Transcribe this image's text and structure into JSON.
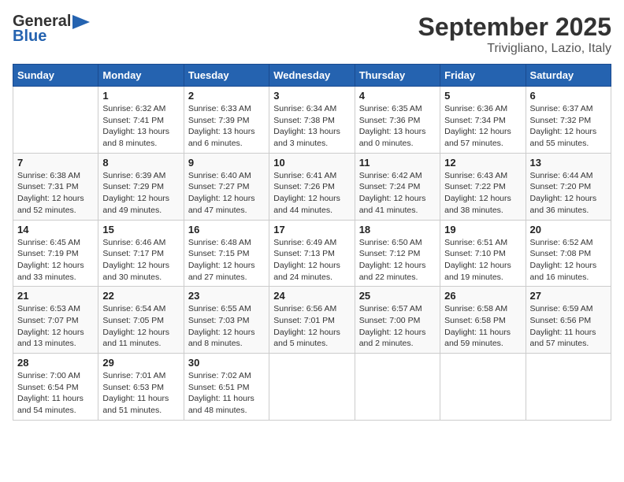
{
  "header": {
    "logo_general": "General",
    "logo_blue": "Blue",
    "month": "September 2025",
    "location": "Trivigliano, Lazio, Italy"
  },
  "days_of_week": [
    "Sunday",
    "Monday",
    "Tuesday",
    "Wednesday",
    "Thursday",
    "Friday",
    "Saturday"
  ],
  "weeks": [
    [
      {
        "day": "",
        "sunrise": "",
        "sunset": "",
        "daylight": ""
      },
      {
        "day": "1",
        "sunrise": "Sunrise: 6:32 AM",
        "sunset": "Sunset: 7:41 PM",
        "daylight": "Daylight: 13 hours and 8 minutes."
      },
      {
        "day": "2",
        "sunrise": "Sunrise: 6:33 AM",
        "sunset": "Sunset: 7:39 PM",
        "daylight": "Daylight: 13 hours and 6 minutes."
      },
      {
        "day": "3",
        "sunrise": "Sunrise: 6:34 AM",
        "sunset": "Sunset: 7:38 PM",
        "daylight": "Daylight: 13 hours and 3 minutes."
      },
      {
        "day": "4",
        "sunrise": "Sunrise: 6:35 AM",
        "sunset": "Sunset: 7:36 PM",
        "daylight": "Daylight: 13 hours and 0 minutes."
      },
      {
        "day": "5",
        "sunrise": "Sunrise: 6:36 AM",
        "sunset": "Sunset: 7:34 PM",
        "daylight": "Daylight: 12 hours and 57 minutes."
      },
      {
        "day": "6",
        "sunrise": "Sunrise: 6:37 AM",
        "sunset": "Sunset: 7:32 PM",
        "daylight": "Daylight: 12 hours and 55 minutes."
      }
    ],
    [
      {
        "day": "7",
        "sunrise": "Sunrise: 6:38 AM",
        "sunset": "Sunset: 7:31 PM",
        "daylight": "Daylight: 12 hours and 52 minutes."
      },
      {
        "day": "8",
        "sunrise": "Sunrise: 6:39 AM",
        "sunset": "Sunset: 7:29 PM",
        "daylight": "Daylight: 12 hours and 49 minutes."
      },
      {
        "day": "9",
        "sunrise": "Sunrise: 6:40 AM",
        "sunset": "Sunset: 7:27 PM",
        "daylight": "Daylight: 12 hours and 47 minutes."
      },
      {
        "day": "10",
        "sunrise": "Sunrise: 6:41 AM",
        "sunset": "Sunset: 7:26 PM",
        "daylight": "Daylight: 12 hours and 44 minutes."
      },
      {
        "day": "11",
        "sunrise": "Sunrise: 6:42 AM",
        "sunset": "Sunset: 7:24 PM",
        "daylight": "Daylight: 12 hours and 41 minutes."
      },
      {
        "day": "12",
        "sunrise": "Sunrise: 6:43 AM",
        "sunset": "Sunset: 7:22 PM",
        "daylight": "Daylight: 12 hours and 38 minutes."
      },
      {
        "day": "13",
        "sunrise": "Sunrise: 6:44 AM",
        "sunset": "Sunset: 7:20 PM",
        "daylight": "Daylight: 12 hours and 36 minutes."
      }
    ],
    [
      {
        "day": "14",
        "sunrise": "Sunrise: 6:45 AM",
        "sunset": "Sunset: 7:19 PM",
        "daylight": "Daylight: 12 hours and 33 minutes."
      },
      {
        "day": "15",
        "sunrise": "Sunrise: 6:46 AM",
        "sunset": "Sunset: 7:17 PM",
        "daylight": "Daylight: 12 hours and 30 minutes."
      },
      {
        "day": "16",
        "sunrise": "Sunrise: 6:48 AM",
        "sunset": "Sunset: 7:15 PM",
        "daylight": "Daylight: 12 hours and 27 minutes."
      },
      {
        "day": "17",
        "sunrise": "Sunrise: 6:49 AM",
        "sunset": "Sunset: 7:13 PM",
        "daylight": "Daylight: 12 hours and 24 minutes."
      },
      {
        "day": "18",
        "sunrise": "Sunrise: 6:50 AM",
        "sunset": "Sunset: 7:12 PM",
        "daylight": "Daylight: 12 hours and 22 minutes."
      },
      {
        "day": "19",
        "sunrise": "Sunrise: 6:51 AM",
        "sunset": "Sunset: 7:10 PM",
        "daylight": "Daylight: 12 hours and 19 minutes."
      },
      {
        "day": "20",
        "sunrise": "Sunrise: 6:52 AM",
        "sunset": "Sunset: 7:08 PM",
        "daylight": "Daylight: 12 hours and 16 minutes."
      }
    ],
    [
      {
        "day": "21",
        "sunrise": "Sunrise: 6:53 AM",
        "sunset": "Sunset: 7:07 PM",
        "daylight": "Daylight: 12 hours and 13 minutes."
      },
      {
        "day": "22",
        "sunrise": "Sunrise: 6:54 AM",
        "sunset": "Sunset: 7:05 PM",
        "daylight": "Daylight: 12 hours and 11 minutes."
      },
      {
        "day": "23",
        "sunrise": "Sunrise: 6:55 AM",
        "sunset": "Sunset: 7:03 PM",
        "daylight": "Daylight: 12 hours and 8 minutes."
      },
      {
        "day": "24",
        "sunrise": "Sunrise: 6:56 AM",
        "sunset": "Sunset: 7:01 PM",
        "daylight": "Daylight: 12 hours and 5 minutes."
      },
      {
        "day": "25",
        "sunrise": "Sunrise: 6:57 AM",
        "sunset": "Sunset: 7:00 PM",
        "daylight": "Daylight: 12 hours and 2 minutes."
      },
      {
        "day": "26",
        "sunrise": "Sunrise: 6:58 AM",
        "sunset": "Sunset: 6:58 PM",
        "daylight": "Daylight: 11 hours and 59 minutes."
      },
      {
        "day": "27",
        "sunrise": "Sunrise: 6:59 AM",
        "sunset": "Sunset: 6:56 PM",
        "daylight": "Daylight: 11 hours and 57 minutes."
      }
    ],
    [
      {
        "day": "28",
        "sunrise": "Sunrise: 7:00 AM",
        "sunset": "Sunset: 6:54 PM",
        "daylight": "Daylight: 11 hours and 54 minutes."
      },
      {
        "day": "29",
        "sunrise": "Sunrise: 7:01 AM",
        "sunset": "Sunset: 6:53 PM",
        "daylight": "Daylight: 11 hours and 51 minutes."
      },
      {
        "day": "30",
        "sunrise": "Sunrise: 7:02 AM",
        "sunset": "Sunset: 6:51 PM",
        "daylight": "Daylight: 11 hours and 48 minutes."
      },
      {
        "day": "",
        "sunrise": "",
        "sunset": "",
        "daylight": ""
      },
      {
        "day": "",
        "sunrise": "",
        "sunset": "",
        "daylight": ""
      },
      {
        "day": "",
        "sunrise": "",
        "sunset": "",
        "daylight": ""
      },
      {
        "day": "",
        "sunrise": "",
        "sunset": "",
        "daylight": ""
      }
    ]
  ]
}
